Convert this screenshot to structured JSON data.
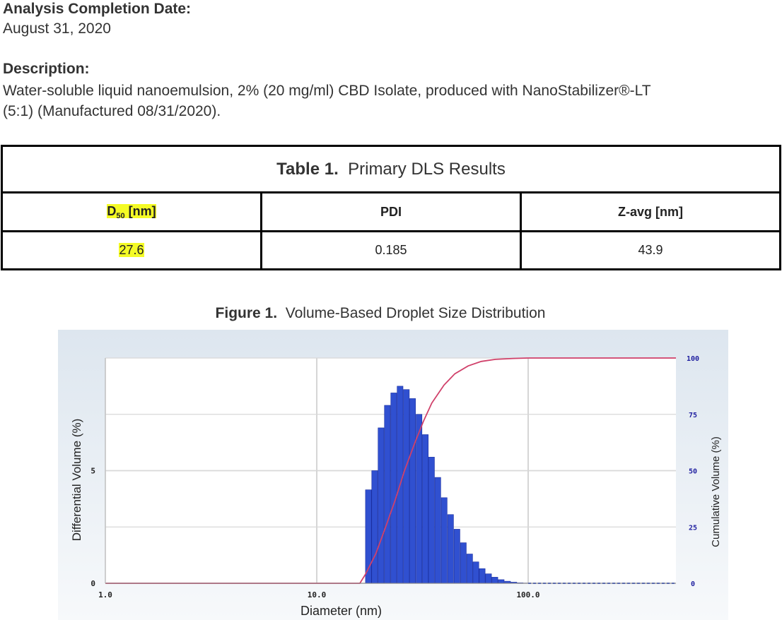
{
  "analysis": {
    "label": "Analysis Completion  Date:",
    "value": "August 31, 2020"
  },
  "description": {
    "label": "Description:",
    "line1": "Water-soluble liquid nanoemulsion, 2% (20 mg/ml) CBD Isolate, produced with NanoStabilizer®-LT",
    "line2": "(5:1) (Manufactured 08/31/2020)."
  },
  "table": {
    "title_bold": "Table 1.",
    "title_rest": "Primary DLS Results",
    "col1_main": "D",
    "col1_sub": "50",
    "col1_unit": " [nm]",
    "col2": "PDI",
    "col3": "Z-avg [nm]",
    "row": [
      "27.6",
      "0.185",
      "43.9"
    ]
  },
  "figure": {
    "caption_bold": "Figure 1.",
    "caption_rest": "Volume-Based Droplet Size Distribution"
  },
  "chart_data": {
    "type": "bar",
    "xlabel": "Diameter (nm)",
    "ylabel": "Differential Volume (%)",
    "y2label": "Cumulative Volume (%)",
    "x_scale": "log",
    "xlim": [
      1.0,
      500
    ],
    "x_ticks": [
      "1.0",
      "10.0",
      "100.0"
    ],
    "ylim": [
      0,
      10
    ],
    "y_ticks": [
      "0",
      "5"
    ],
    "y2lim": [
      0,
      100
    ],
    "y2_ticks": [
      "0",
      "25",
      "50",
      "75",
      "100"
    ],
    "grid": true,
    "colors": {
      "bars": "#3050d0",
      "cumulative": "#d0406a",
      "right_axis_labels": "#2020a0"
    },
    "series": [
      {
        "kind": "bar",
        "x": [
          17.0,
          18.2,
          19.5,
          20.9,
          22.4,
          24.0,
          25.7,
          27.5,
          29.5,
          31.6,
          33.8,
          36.2,
          38.8,
          41.6,
          44.6,
          47.8,
          51.2,
          54.8,
          58.7,
          62.9,
          67.4,
          72.2,
          77.4,
          82.9,
          88.8,
          95.1
        ],
        "values": [
          4.15,
          5.0,
          6.9,
          7.9,
          8.45,
          8.75,
          8.6,
          8.2,
          7.5,
          6.6,
          5.6,
          4.7,
          3.8,
          3.05,
          2.4,
          1.8,
          1.3,
          0.95,
          0.65,
          0.42,
          0.27,
          0.16,
          0.09,
          0.05,
          0.02,
          0.01
        ]
      },
      {
        "kind": "line",
        "x": [
          1.0,
          16.0,
          17.0,
          19.0,
          21.0,
          23.5,
          26.0,
          29.0,
          32.0,
          35.0,
          40.0,
          45.0,
          52.0,
          60.0,
          70.0,
          85.0,
          100.0,
          500.0
        ],
        "values": [
          0,
          0,
          4,
          13,
          24,
          37,
          50,
          62,
          72,
          80,
          88,
          93,
          96.5,
          98.5,
          99.4,
          99.8,
          100,
          100
        ]
      }
    ]
  }
}
